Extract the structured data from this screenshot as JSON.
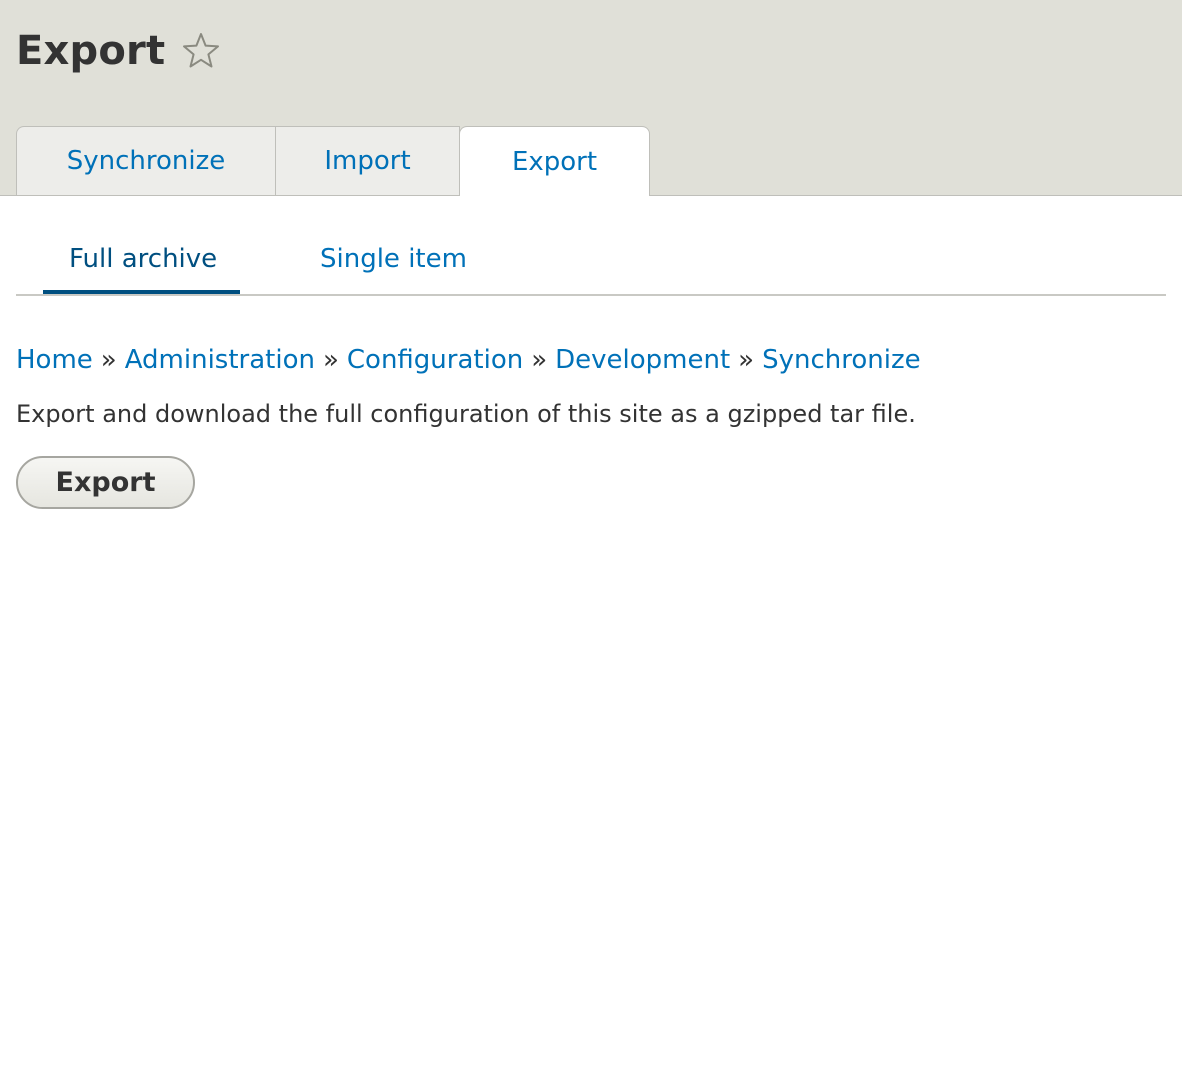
{
  "page": {
    "title": "Export",
    "star_icon": "star-outline-icon"
  },
  "tabs": [
    {
      "label": "Synchronize",
      "active": false
    },
    {
      "label": "Import",
      "active": false
    },
    {
      "label": "Export",
      "active": true
    }
  ],
  "subtabs": [
    {
      "label": "Full archive",
      "active": true
    },
    {
      "label": "Single item",
      "active": false
    }
  ],
  "breadcrumb": {
    "items": [
      "Home",
      "Administration",
      "Configuration",
      "Development",
      "Synchronize"
    ],
    "separator": "»"
  },
  "content": {
    "description": "Export and download the full configuration of this site as a gzipped tar file.",
    "export_button_label": "Export"
  },
  "colors": {
    "header_bg": "#e0e0d8",
    "link": "#0071b8",
    "active_subtab": "#004f80"
  }
}
